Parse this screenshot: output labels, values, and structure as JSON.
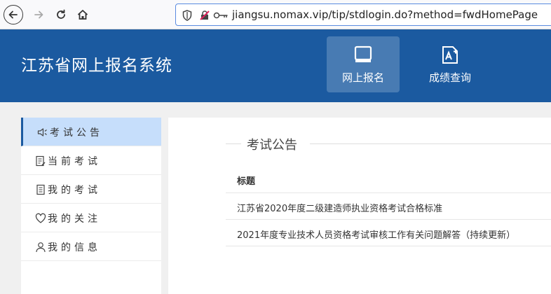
{
  "browser": {
    "url": "jiangsu.nomax.vip/tip/stdlogin.do?method=fwdHomePage"
  },
  "header": {
    "title": "江苏省网上报名系统",
    "tabs": [
      {
        "label": "网上报名",
        "icon": "monitor-icon",
        "active": true
      },
      {
        "label": "成绩查询",
        "icon": "grade-icon",
        "active": false
      }
    ]
  },
  "sidebar": {
    "items": [
      {
        "label": "考试公告",
        "icon": "speaker-icon",
        "active": true
      },
      {
        "label": "当前考试",
        "icon": "document-edit-icon",
        "active": false
      },
      {
        "label": "我的考试",
        "icon": "book-icon",
        "active": false
      },
      {
        "label": "我的关注",
        "icon": "heart-icon",
        "active": false
      },
      {
        "label": "我的信息",
        "icon": "user-icon",
        "active": false
      }
    ]
  },
  "main": {
    "section_title": "考试公告",
    "column_header": "标题",
    "rows": [
      {
        "title": "江苏省2020年度二级建造师执业资格考试合格标准"
      },
      {
        "title": "2021年度专业技术人员资格考试审核工作有关问题解答（持续更新）"
      }
    ]
  },
  "colors": {
    "header_bg": "#1b5aa0",
    "sidebar_active_bg": "#c6defb",
    "url_border": "#5a8be0"
  }
}
